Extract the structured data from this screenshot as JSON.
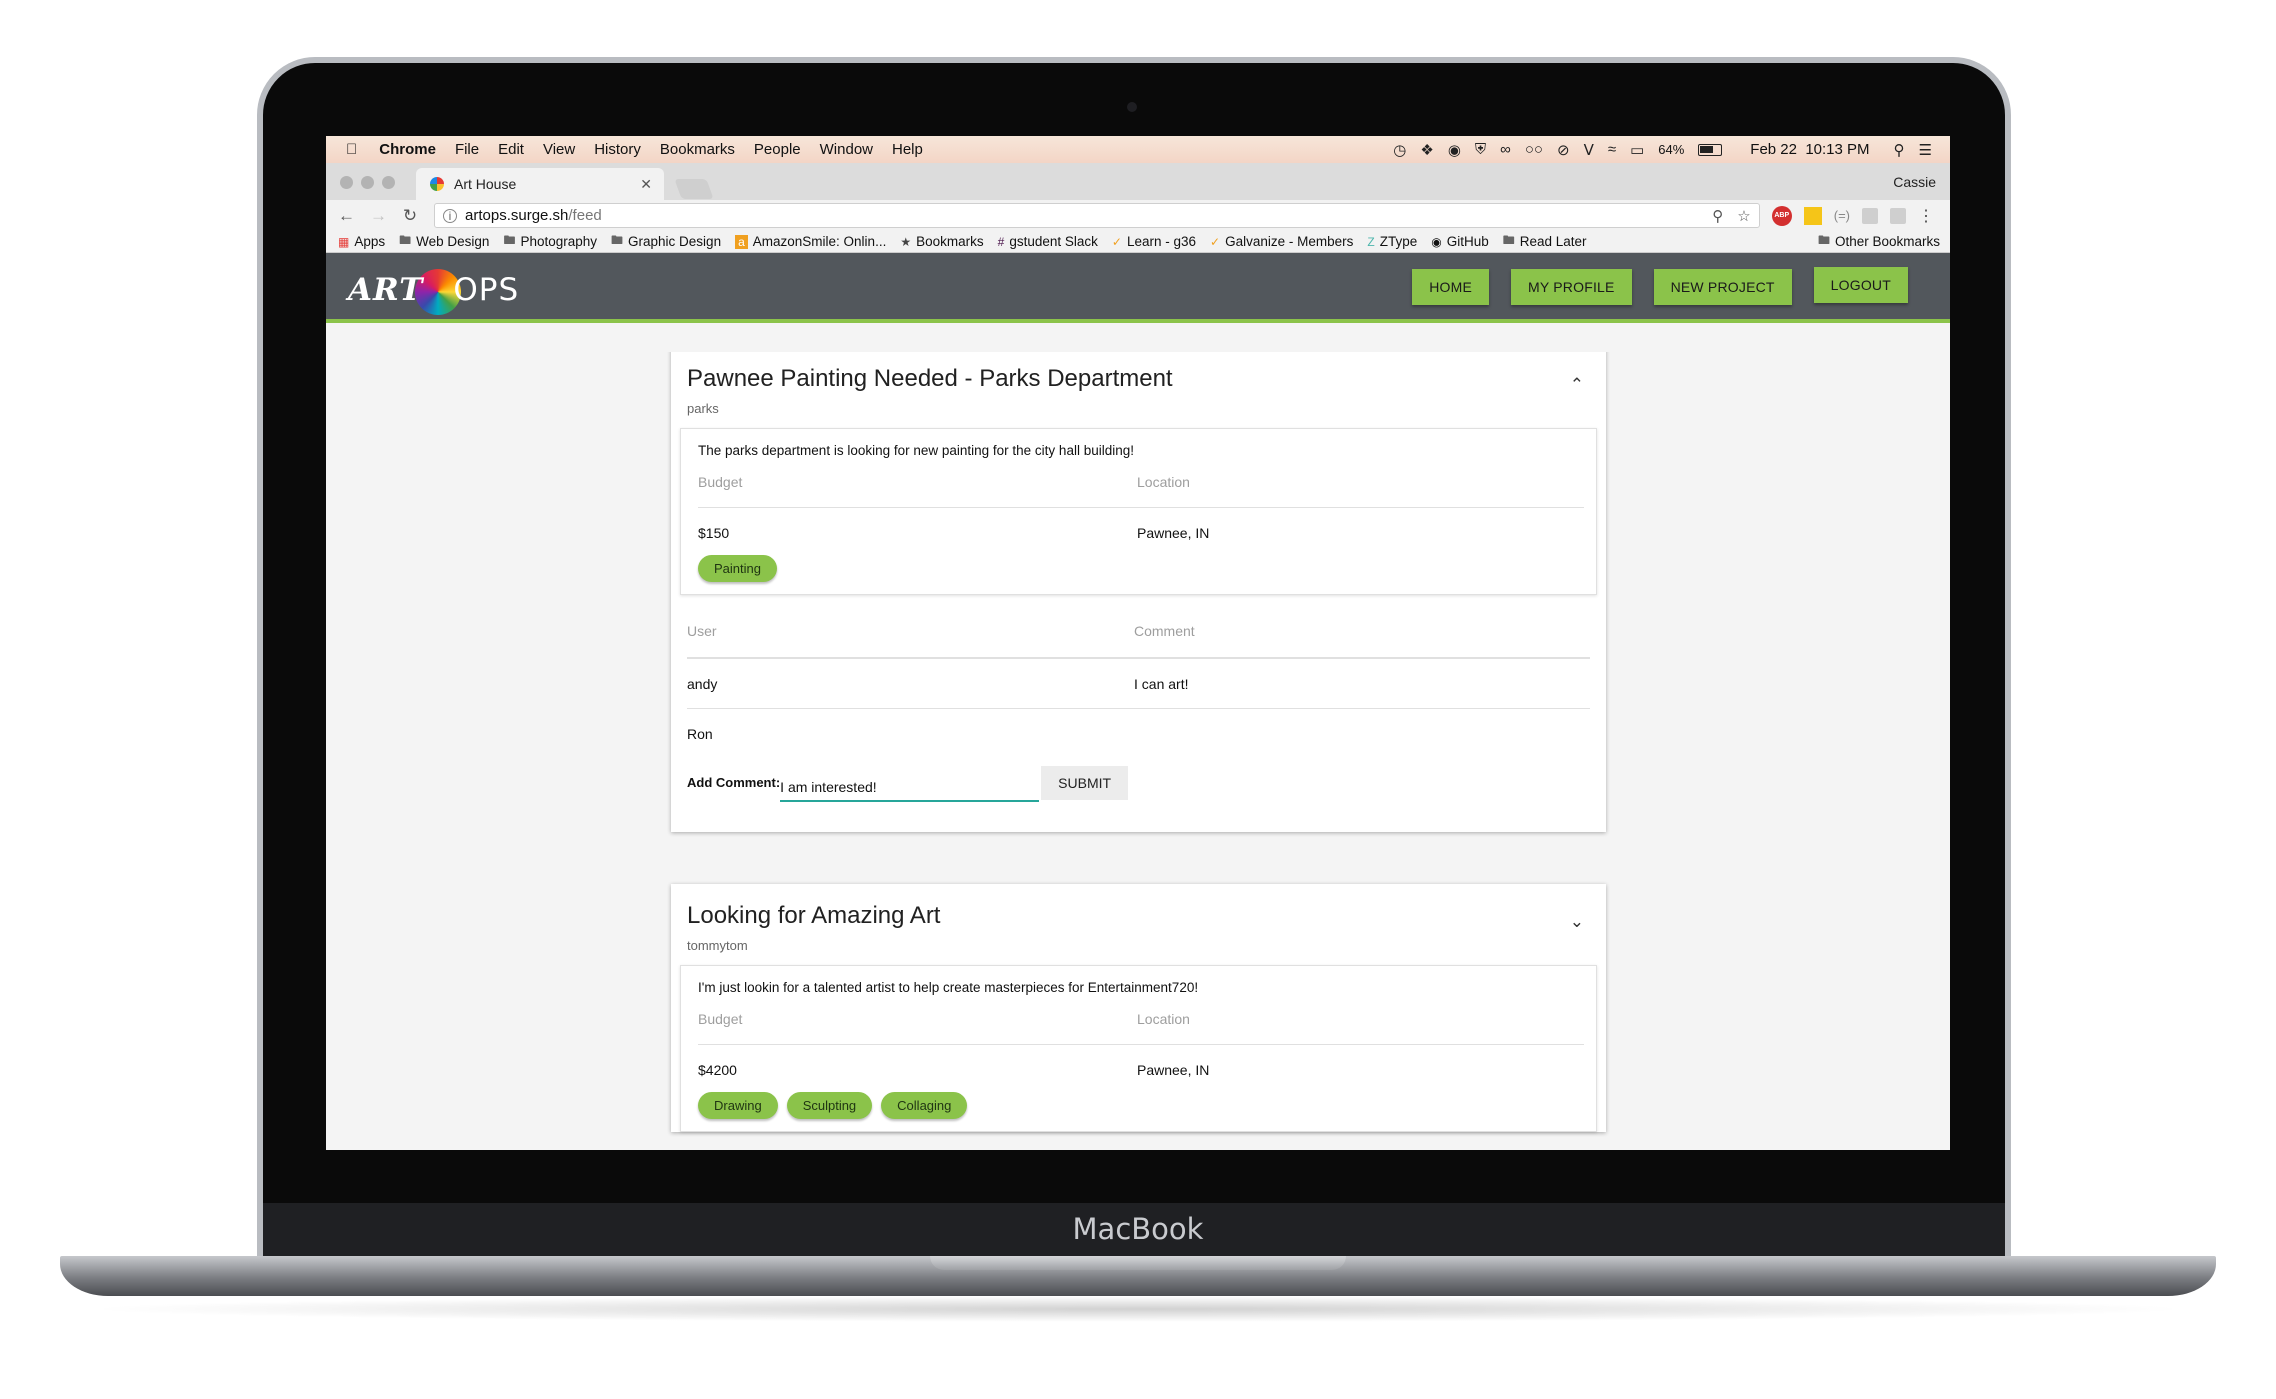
{
  "device": {
    "label": "MacBook"
  },
  "menubar": {
    "items": [
      "Chrome",
      "File",
      "Edit",
      "View",
      "History",
      "Bookmarks",
      "People",
      "Window",
      "Help"
    ],
    "battery": "64%",
    "datetime": "Feb 22  10:13 PM"
  },
  "browser": {
    "tab_title": "Art House",
    "profile": "Cassie",
    "url_host": "artops.surge.sh",
    "url_path": "/feed",
    "bookmarks": [
      "Apps",
      "Web Design",
      "Photography",
      "Graphic Design",
      "AmazonSmile: Onlin...",
      "Bookmarks",
      "gstudent Slack",
      "Learn - g36",
      "Galvanize - Members",
      "ZType",
      "GitHub",
      "Read Later"
    ],
    "other_bookmarks": "Other Bookmarks"
  },
  "app": {
    "logo_left": "ART",
    "logo_right": "OPS",
    "nav": [
      "HOME",
      "MY PROFILE",
      "NEW PROJECT",
      "LOGOUT"
    ],
    "accent_color": "#8bc34a",
    "header_color": "#52575c"
  },
  "projects": [
    {
      "title": "Pawnee Painting Needed - Parks Department",
      "owner": "parks",
      "description": "The parks department is looking for new painting for the city hall building!",
      "budget_label": "Budget",
      "location_label": "Location",
      "budget": "$150",
      "location": "Pawnee, IN",
      "tags": [
        "Painting"
      ],
      "comments_header": {
        "user": "User",
        "comment": "Comment"
      },
      "comments": [
        {
          "user": "andy",
          "comment": "I can art!"
        },
        {
          "user": "Ron",
          "comment": ""
        }
      ],
      "add_comment_label": "Add Comment:",
      "add_comment_value": "I am interested!",
      "submit_label": "SUBMIT"
    },
    {
      "title": "Looking for Amazing Art",
      "owner": "tommytom",
      "description": "I'm just lookin for a talented artist to help create masterpieces for Entertainment720!",
      "budget_label": "Budget",
      "location_label": "Location",
      "budget": "$4200",
      "location": "Pawnee, IN",
      "tags": [
        "Drawing",
        "Sculpting",
        "Collaging"
      ]
    }
  ]
}
